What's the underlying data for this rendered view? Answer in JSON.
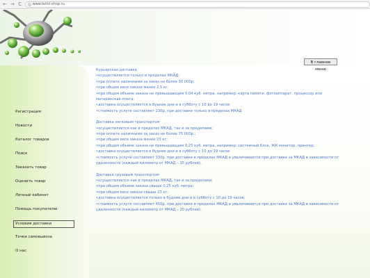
{
  "browser": {
    "back_glyph": "←",
    "forward_glyph": "→",
    "reload_glyph": "C",
    "url": "www.bolni-shop.ru"
  },
  "header": {
    "button_label": "В главное меню",
    "colors": {
      "accent": "#6cb33f",
      "sidebar": "#dcedb8"
    }
  },
  "sidebar": {
    "items": [
      {
        "label": "Регистрация"
      },
      {
        "label": "Новости"
      },
      {
        "label": "Каталог товаров"
      },
      {
        "label": "Поиск"
      },
      {
        "label": "Заказать товар"
      },
      {
        "label": "Оценить товар"
      },
      {
        "label": "Личный кабинет"
      },
      {
        "label": "Помощь покупателю"
      },
      {
        "label": "Условия доставки"
      },
      {
        "label": "Точки самовывоза"
      },
      {
        "label": "О нас"
      }
    ],
    "active_index": 8
  },
  "content": {
    "sections": [
      {
        "title": "Курьерская доставка",
        "lines": [
          "•осуществляется только в пределах МКАД;",
          "•при оплате наличными за заказ не более 30 000р;",
          "•при общем весе заказа менее 2,5 кг;",
          "•при общем объеме заказа не превышающим 0,04 куб. метра, например: карта памяти, фотоаппарат, процессор или",
          "материнская плата;",
          "•доставка осуществляется в будние дни и в субботу с 10 до 19 часов",
          "•стоимость услуги составляет 230р. при доставке только в пределах МКАД"
        ]
      },
      {
        "title": "Доставка легковым транспортом",
        "lines": [
          "•осуществляется как в пределах МКАД, так и за пределами;",
          "•при оплате наличными за заказ не более 75 000р.;",
          "•при общем весе заказа менее 23 кг;",
          "•при общем объеме заказа не превышающим 0,25 куб. метра, например: системный блок, ЖК монитор, принтер;",
          "•доставка осуществляется в будние дни и в субботу с 10 до 19 часов",
          "•стоимость услуги составляет 330р. при доставке в пределах МКАД и увеличивается при доставке за МКАД в зависимости от",
          "удаленности (каждый километр от МКАД – 15 рублей)."
        ]
      },
      {
        "title": "Доставка грузовым транспортом",
        "lines": [
          "•осуществляется как в пределах МКАД, так и за пределами;",
          "•при общем объеме заказа свыше 0,25 куб. метра;",
          "•при общем весе заказа свыше 23 кг;",
          "•доставка осуществляется только в будние дни и в субботу с 10 до 19 часов;",
          "•стоимость услуги составляет 450р. при доставке в пределах МКАД и увеличивается при доставке за МКАД в зависимости от",
          "удаленности (каждый километр от МКАД – 20 рублей)."
        ]
      }
    ]
  }
}
